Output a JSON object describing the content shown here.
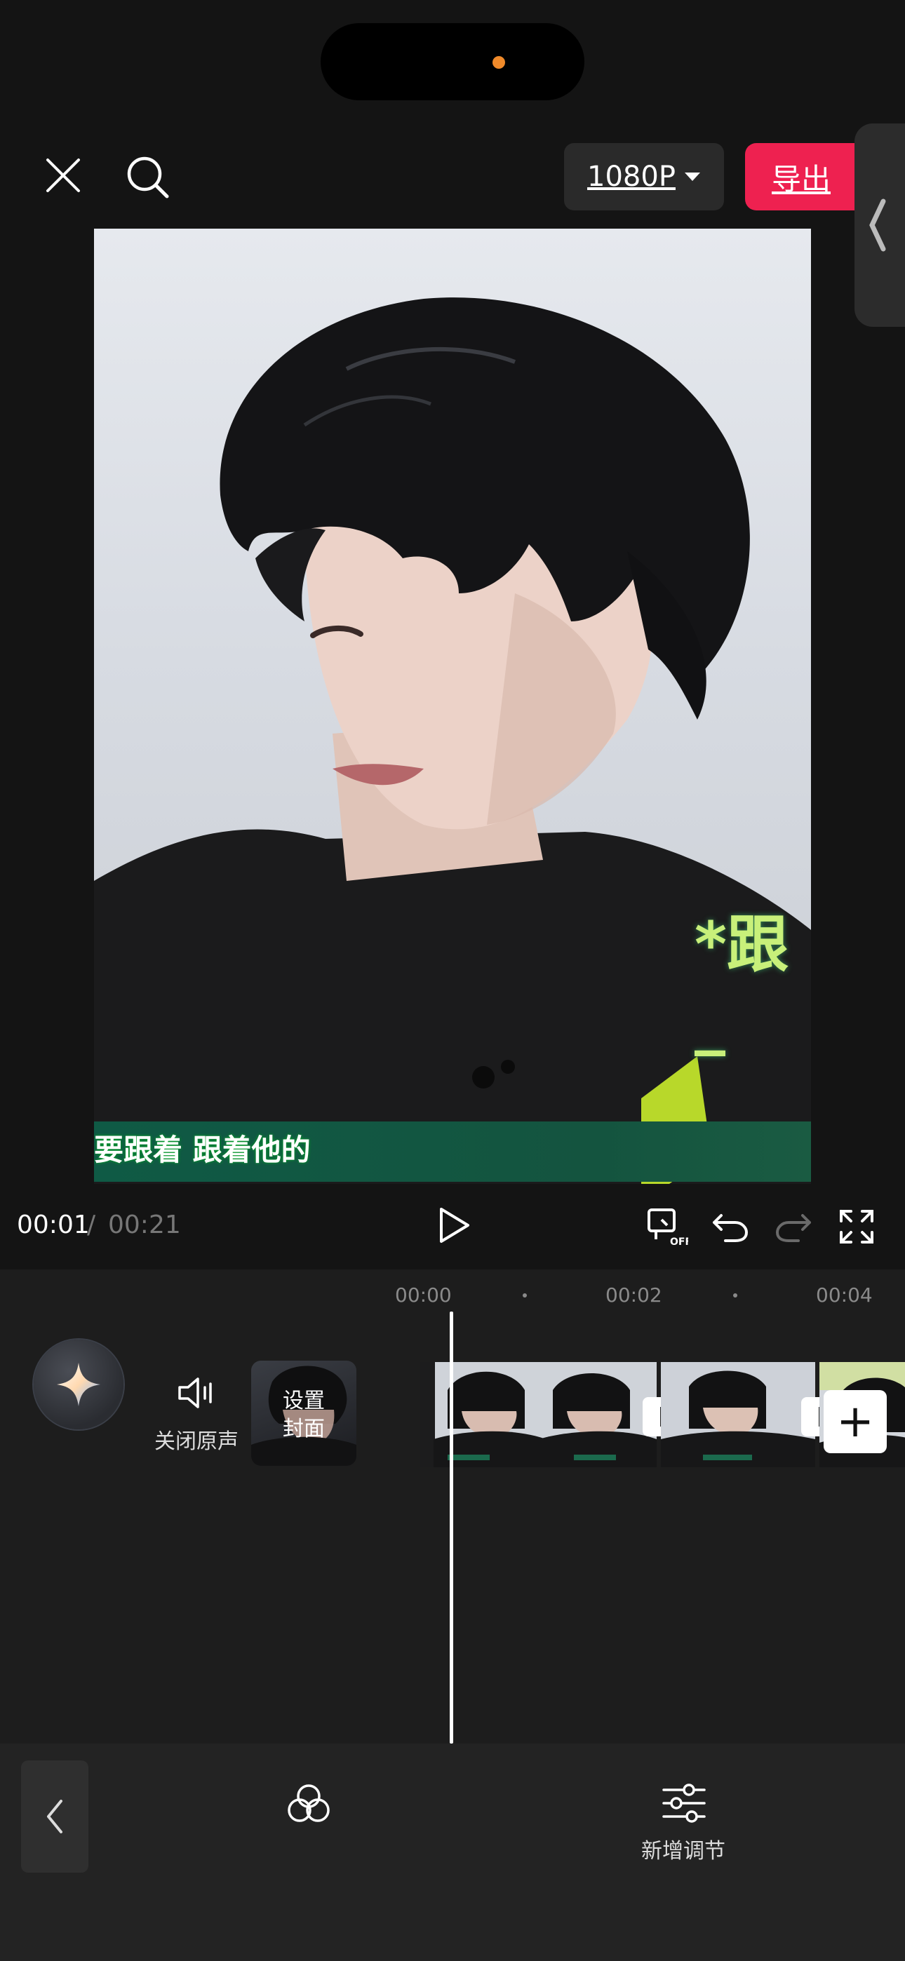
{
  "header": {
    "resolution_label": "1080P",
    "export_label": "导出"
  },
  "preview": {
    "subtitle": "要跟着 跟着他的",
    "overlay_caption": "*跟_"
  },
  "playback": {
    "current_time": "00:01",
    "separator": "/",
    "total_time": "00:21"
  },
  "timeline": {
    "ruler": [
      "00:00",
      "00:02",
      "00:04"
    ],
    "mute_label": "关闭原声",
    "cover_label_line1": "设置",
    "cover_label_line2": "封面",
    "add_clip_symbol": "+"
  },
  "toolbar": {
    "adjust_label": "新增调节"
  },
  "colors": {
    "background": "#141414",
    "export_accent": "#ee2150",
    "timeline_bg": "#1d1d1d",
    "toolbar_bg": "#232323"
  }
}
